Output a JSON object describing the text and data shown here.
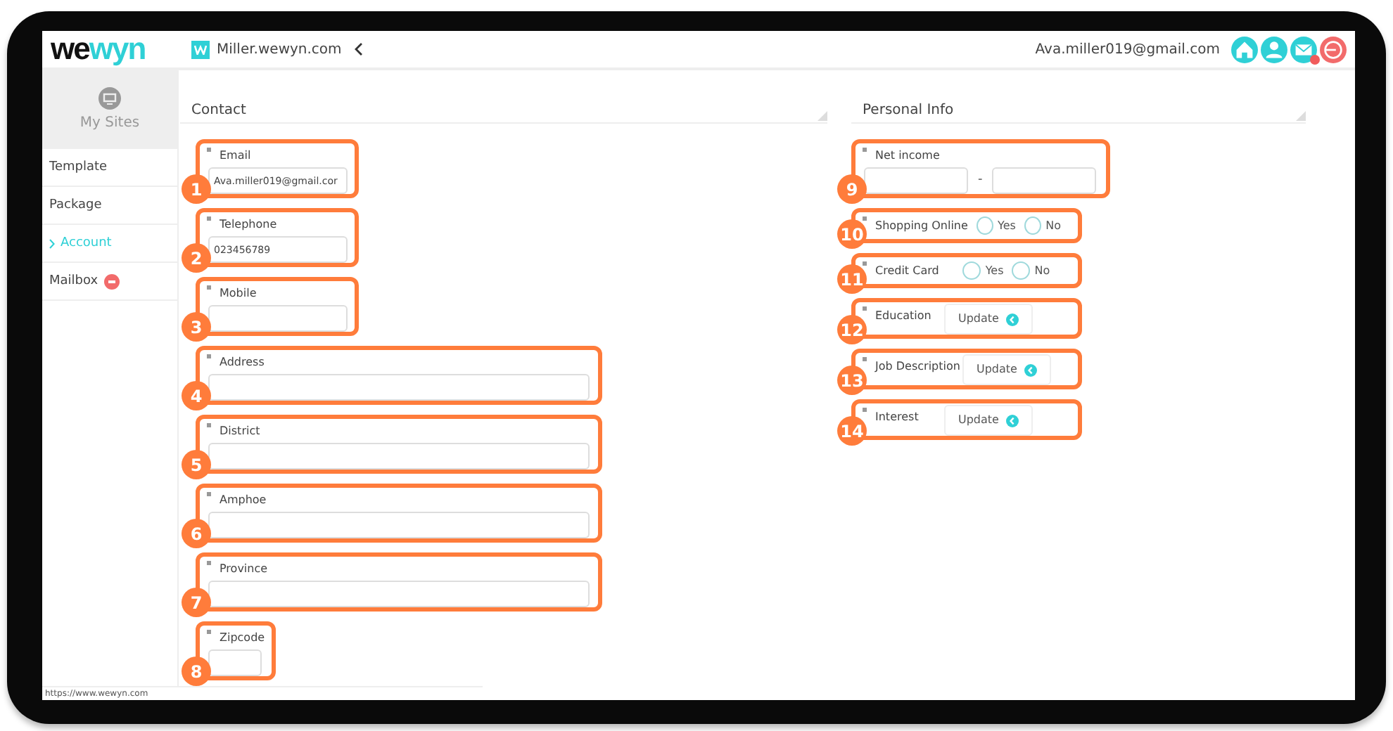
{
  "header": {
    "logo": {
      "dark": "we",
      "accent": "wyn"
    },
    "site": "Miller.wewyn.com",
    "user_email": "Ava.miller019@gmail.com",
    "mail_unread": true
  },
  "sidebar": {
    "title": "My Sites",
    "items": [
      {
        "label": "Template",
        "selected": false,
        "alert": false
      },
      {
        "label": "Package",
        "selected": false,
        "alert": false
      },
      {
        "label": "Account",
        "selected": true,
        "alert": false
      },
      {
        "label": "Mailbox",
        "selected": false,
        "alert": true
      }
    ]
  },
  "contact": {
    "title": "Contact",
    "fields": [
      {
        "marker": "1",
        "label": "Email",
        "value": "Ava.miller019@gmail.cor",
        "kind": "short"
      },
      {
        "marker": "2",
        "label": "Telephone",
        "value": "023456789",
        "kind": "short"
      },
      {
        "marker": "3",
        "label": "Mobile",
        "kind": "short"
      },
      {
        "marker": "4",
        "label": "Address",
        "kind": "long"
      },
      {
        "marker": "5",
        "label": "District",
        "kind": "long"
      },
      {
        "marker": "6",
        "label": "Amphoe",
        "kind": "long"
      },
      {
        "marker": "7",
        "label": "Province",
        "kind": "long"
      },
      {
        "marker": "8",
        "label": "Zipcode",
        "kind": "tiny"
      }
    ]
  },
  "personal_info": {
    "title": "Personal Info",
    "fields": [
      {
        "marker": "9",
        "label": "Net income",
        "kind": "range",
        "separator": "-"
      },
      {
        "marker": "10",
        "label": "Shopping Online",
        "kind": "yesno",
        "options": [
          {
            "label": "Yes",
            "selected": false
          },
          {
            "label": "No",
            "selected": false
          }
        ]
      },
      {
        "marker": "11",
        "label": "Credit Card",
        "kind": "yesno",
        "options": [
          {
            "label": "Yes",
            "selected": false
          },
          {
            "label": "No",
            "selected": false
          }
        ]
      },
      {
        "marker": "12",
        "label": "Education",
        "kind": "update",
        "button": "Update"
      },
      {
        "marker": "13",
        "label": "Job Description",
        "kind": "update",
        "button": "Update"
      },
      {
        "marker": "14",
        "label": "Interest",
        "kind": "update",
        "button": "Update"
      }
    ]
  },
  "status_bar": "https://www.wewyn.com"
}
